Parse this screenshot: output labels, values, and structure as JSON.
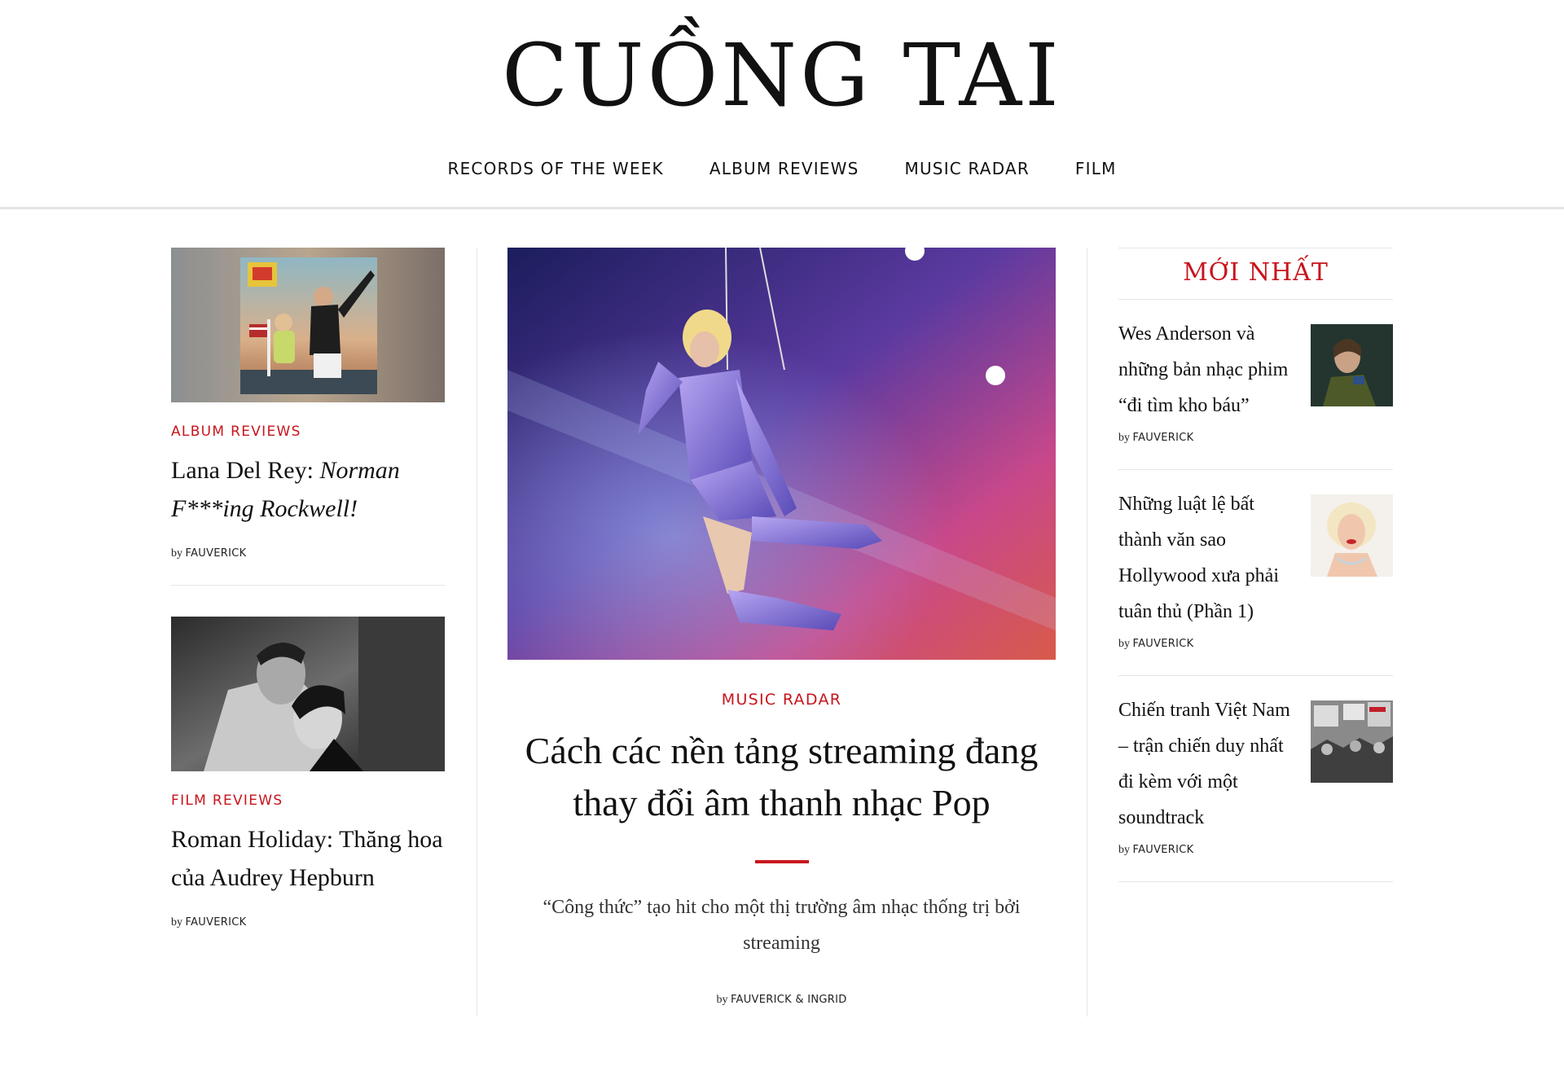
{
  "site": {
    "logo": "CUỒNG TAI"
  },
  "nav": [
    {
      "label": "RECORDS OF THE WEEK"
    },
    {
      "label": "ALBUM REVIEWS"
    },
    {
      "label": "MUSIC RADAR"
    },
    {
      "label": "FILM"
    }
  ],
  "left": {
    "card1": {
      "category": "ALBUM REVIEWS",
      "title_plain": "Lana Del Rey: ",
      "title_italic": "Norman F***ing Rockwell!",
      "by": "by",
      "author": "FAUVERICK"
    },
    "card2": {
      "category": "FILM REVIEWS",
      "title": "Roman Holiday: Thăng hoa của Audrey Hepburn",
      "by": "by",
      "author": "FAUVERICK"
    }
  },
  "feature": {
    "category": "MUSIC RADAR",
    "title": "Cách các nền tảng streaming đang thay đổi âm thanh nhạc Pop",
    "excerpt": "“Công thức” tạo hit cho một thị trường âm nhạc thống trị bởi streaming",
    "by": "by",
    "author": "FAUVERICK & INGRID"
  },
  "latest": {
    "heading": "MỚI NHẤT",
    "items": [
      {
        "title": "Wes Anderson và những bản nhạc phim “đi tìm kho báu”",
        "by": "by",
        "author": "FAUVERICK"
      },
      {
        "title": "Những luật lệ bất thành văn sao Hollywood xưa phải tuân thủ (Phần 1)",
        "by": "by",
        "author": "FAUVERICK"
      },
      {
        "title": "Chiến tranh Việt Nam – trận chiến duy nhất đi kèm với một soundtrack",
        "by": "by",
        "author": "FAUVERICK"
      }
    ]
  },
  "colors": {
    "accent": "#c8151d",
    "text": "#111111",
    "rule": "#e6e6e6"
  }
}
